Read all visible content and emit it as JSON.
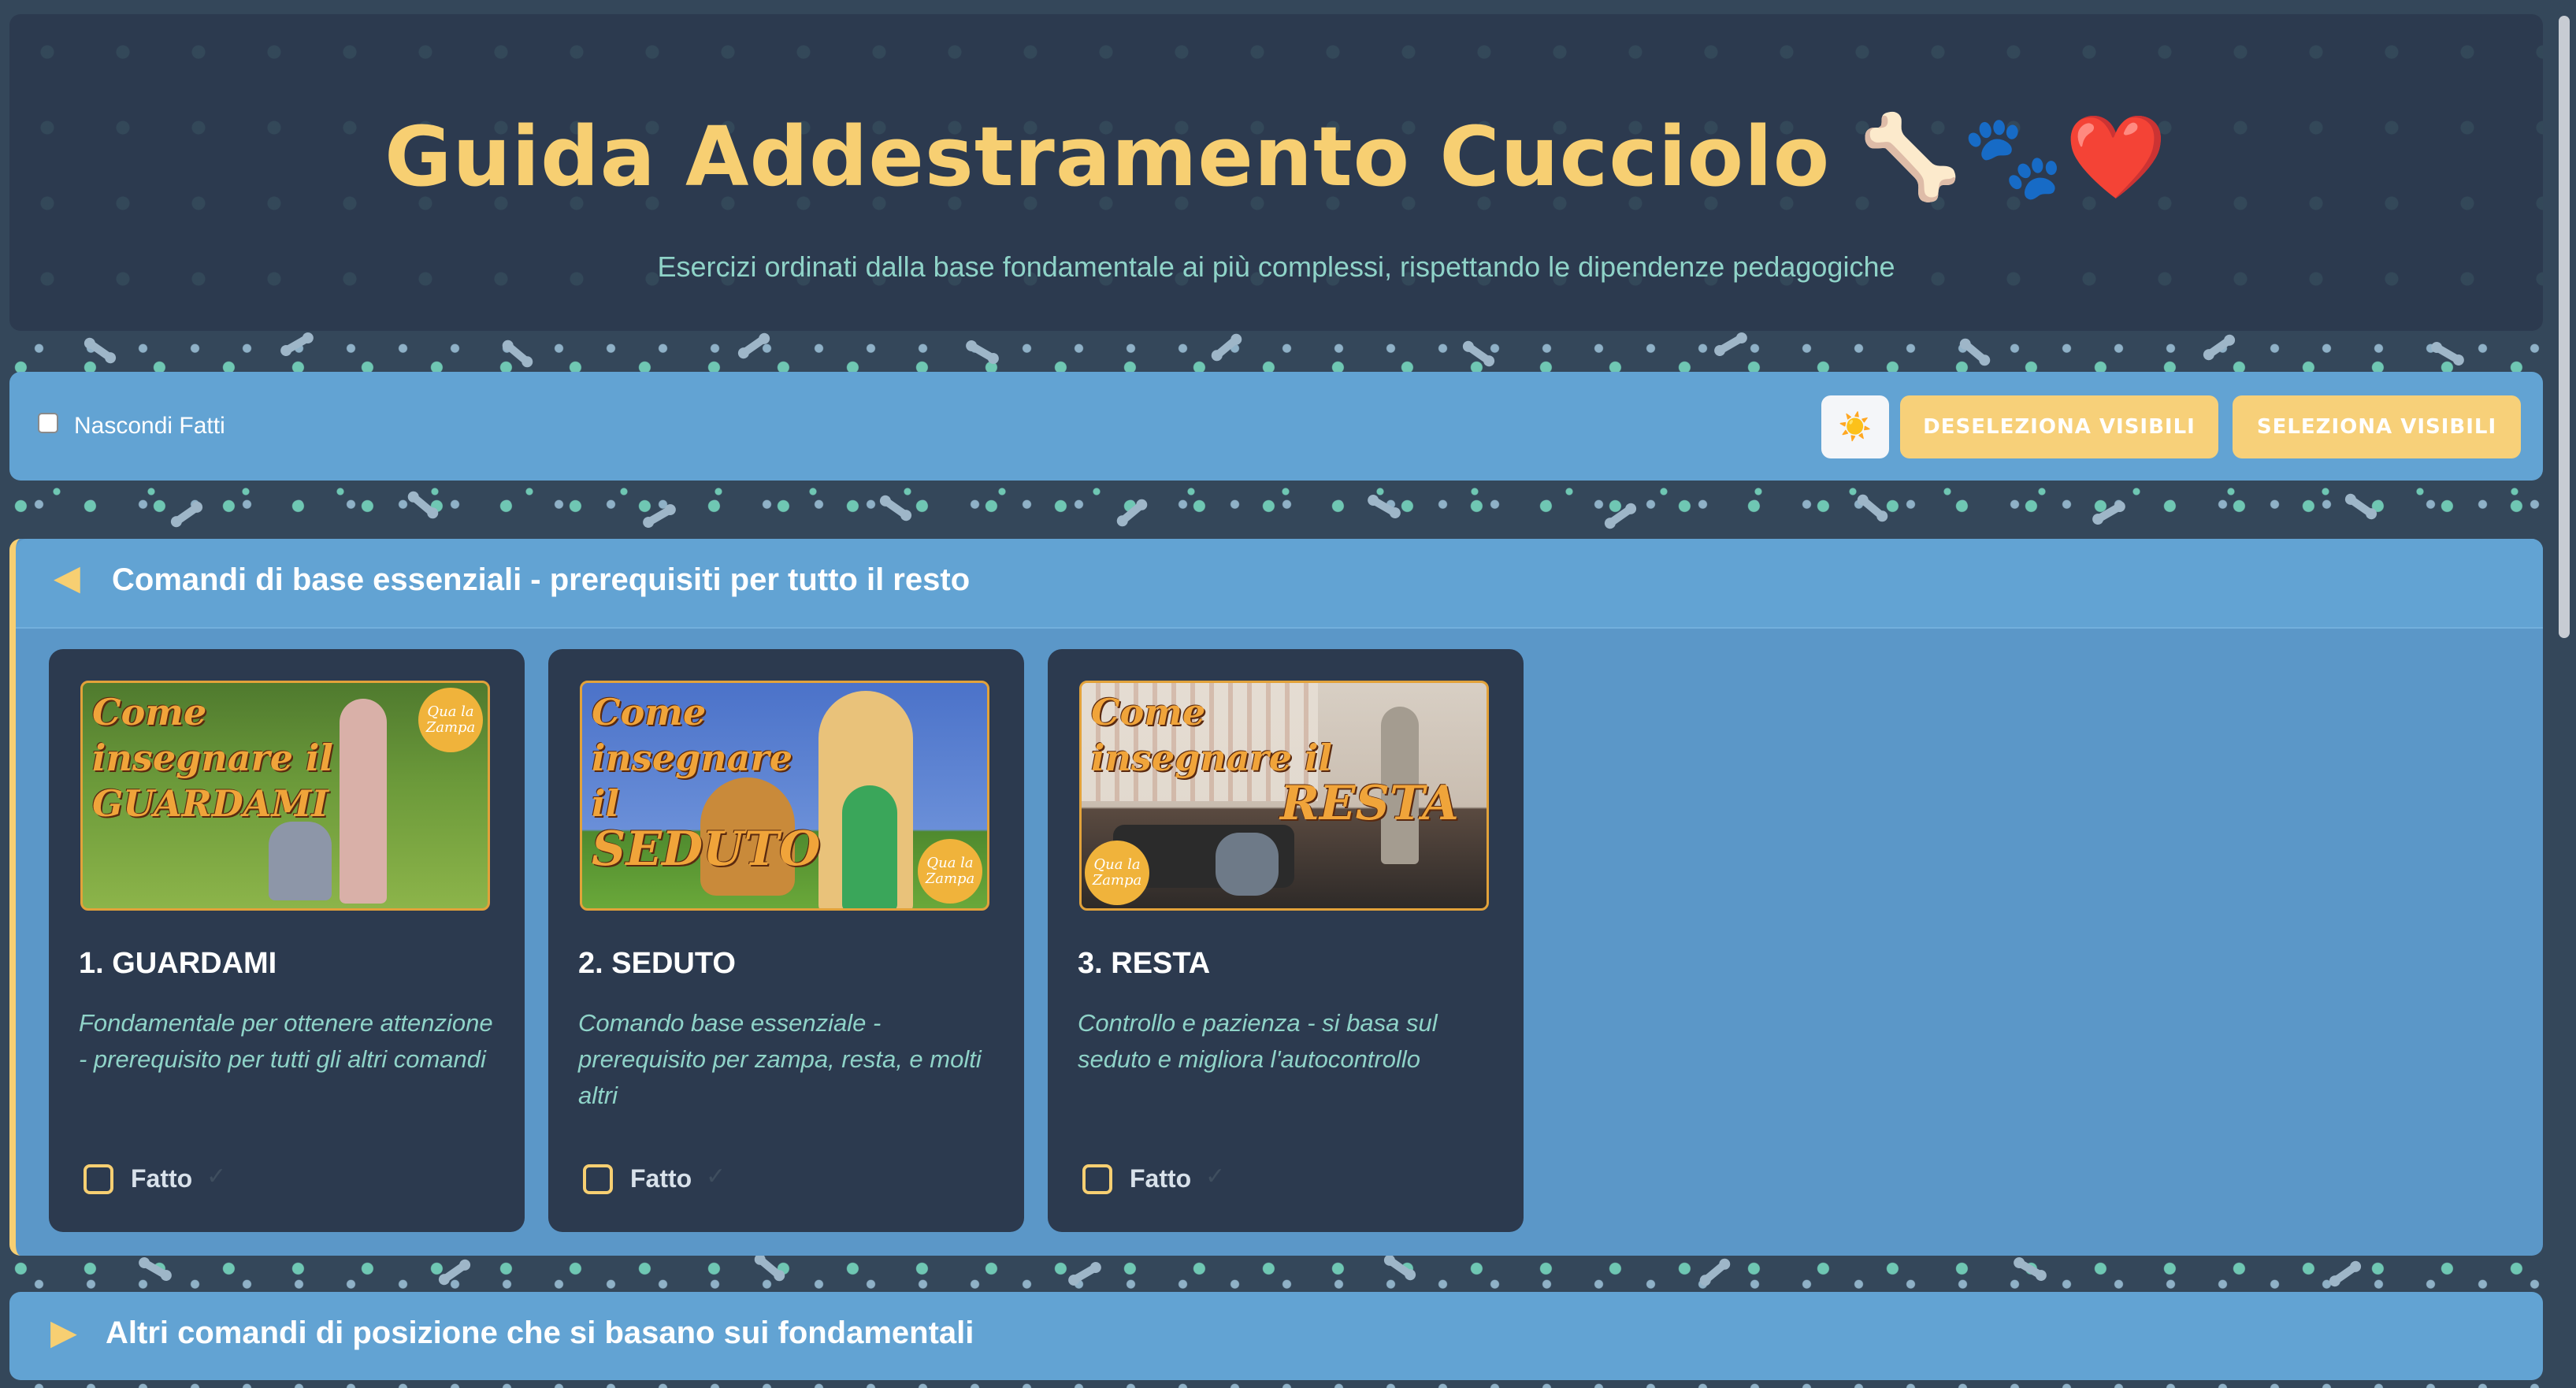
{
  "header": {
    "title": "Guida Addestramento Cucciolo 🦴🐾❤️",
    "subtitle": "Esercizi ordinati dalla base fondamentale ai più complessi, rispettando le dipendenze pedagogiche"
  },
  "toolbar": {
    "hide_done_label": "Nascondi Fatti",
    "theme_icon": "sun-icon",
    "theme_glyph": "☀️",
    "deselect_label": "DESELEZIONA VISIBILI",
    "select_label": "SELEZIONA VISIBILI"
  },
  "sections": [
    {
      "title": "Comandi di base essenziali - prerequisiti per tutto il resto",
      "expanded": true,
      "arrow": "◀",
      "cards": [
        {
          "title": "1. GUARDAMI",
          "description": "Fondamentale per ottenere attenzione - prerequisito per tutti gli altri comandi",
          "thumb_text": [
            "Come",
            "insegnare il",
            "GUARDAMI"
          ],
          "badge": "Qua la Zampa",
          "done_label": "Fatto",
          "done": false
        },
        {
          "title": "2. SEDUTO",
          "description": "Comando base essenziale - prerequisito per zampa, resta, e molti altri",
          "thumb_text": [
            "Come",
            "insegnare",
            "il",
            "SEDUTO"
          ],
          "badge": "Qua la Zampa",
          "done_label": "Fatto",
          "done": false
        },
        {
          "title": "3. RESTA",
          "description": "Controllo e pazienza - si basa sul seduto e migliora l'autocontrollo",
          "thumb_text": [
            "Come",
            "insegnare il",
            "RESTA"
          ],
          "badge": "Qua la Zampa",
          "done_label": "Fatto",
          "done": false
        }
      ]
    },
    {
      "title": "Altri comandi di posizione che si basano sui fondamentali",
      "expanded": false,
      "arrow": "▶"
    }
  ],
  "check_glyph": "✓",
  "colors": {
    "accent": "#f7cf72",
    "panel": "#2c3a4f",
    "section_bg": "#5b97c8",
    "text_teal": "#8fd3c8"
  }
}
